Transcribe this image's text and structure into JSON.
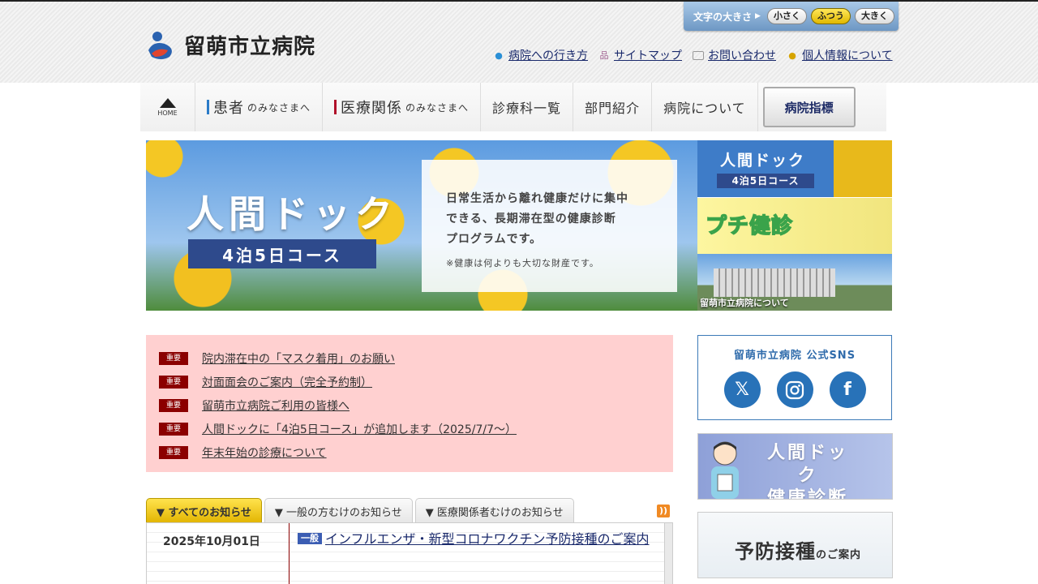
{
  "header": {
    "logo_text": "留萌市立病院",
    "font_size": {
      "label": "文字の大きさ",
      "options": [
        "小さく",
        "ふつう",
        "大きく"
      ],
      "selected": "ふつう"
    },
    "utility_links": [
      {
        "label": "病院への行き方",
        "icon": "map-pin-icon"
      },
      {
        "label": "サイトマップ",
        "icon": "sitemap-icon"
      },
      {
        "label": "お問い合わせ",
        "icon": "mail-icon"
      },
      {
        "label": "個人情報について",
        "icon": "person-icon"
      }
    ]
  },
  "nav": {
    "home": "HOME",
    "patients": {
      "main": "患者",
      "sub": "のみなさまへ"
    },
    "medical": {
      "main": "医療関係",
      "sub": "のみなさまへ"
    },
    "departments": "診療科一覧",
    "divisions": "部門紹介",
    "about": "病院について",
    "index": "病院指標"
  },
  "hero": {
    "title": "人間ドック",
    "course": "4泊5日コース",
    "description": "日常生活から離れ健康だけに集中\nできる、長期滞在型の健康診断\nプログラムです。",
    "note": "※健康は何よりも大切な財産です。"
  },
  "side_thumbs": {
    "dock_title": "人間ドック",
    "dock_course": "4泊5日コース",
    "petit": "プチ健診",
    "about": "留萌市立病院について"
  },
  "notices": {
    "badge": "重要",
    "items": [
      "院内滞在中の「マスク着用」のお願い",
      "対面面会のご案内（完全予約制）",
      "留萌市立病院ご利用の皆様へ",
      "人間ドックに「4泊5日コース」が追加します（2025/7/7～）",
      "年末年始の診療について"
    ]
  },
  "news_tabs": [
    "▼ すべてのお知らせ",
    "▼ 一般の方むけのお知らせ",
    "▼ 医療関係者むけのお知らせ"
  ],
  "news": {
    "date": "2025年10月01日",
    "badge": "一般",
    "title": "インフルエンザ・新型コロナワクチン予防接種のご案内"
  },
  "sns": {
    "title": "留萌市立病院 公式SNS",
    "icons": [
      "x-icon",
      "instagram-icon",
      "facebook-icon"
    ]
  },
  "promos": {
    "dock": "人間ドック\n健康診断",
    "vaccine_main": "予防接種",
    "vaccine_sub": "のご案内"
  },
  "colors": {
    "brand_blue": "#2f6bab",
    "important_red": "#8b0000",
    "notice_bg": "#ffd0d0",
    "active_tab": "#ffd633"
  }
}
